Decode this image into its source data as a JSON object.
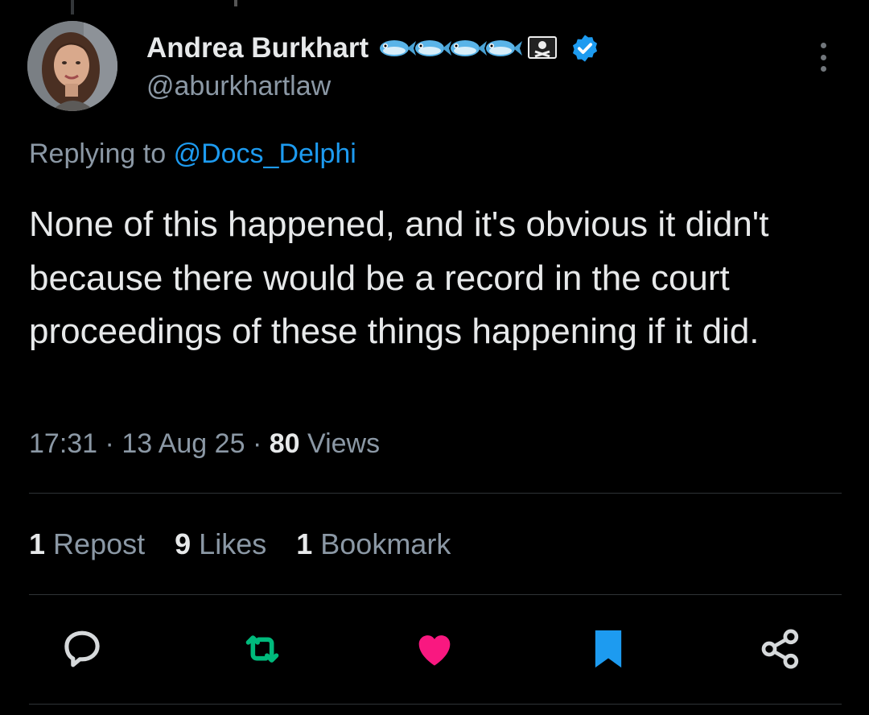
{
  "author": {
    "name": "Andrea Burkhart",
    "handle": "@aburkhartlaw",
    "verified": true,
    "name_emojis": [
      "fish",
      "fish",
      "fish",
      "fish",
      "pirate-flag"
    ]
  },
  "reply": {
    "prefix": "Replying to",
    "mention": "@Docs_Delphi"
  },
  "tweet": {
    "text": "None of this happened, and it's obvious it didn't because there would be a record in the court proceedings of these things happening if it did.",
    "time": "17:31",
    "date": "13 Aug 25",
    "views_count": "80",
    "views_label": "Views",
    "separator": "·"
  },
  "stats": {
    "reposts_count": "1",
    "reposts_label": "Repost",
    "likes_count": "9",
    "likes_label": "Likes",
    "bookmarks_count": "1",
    "bookmarks_label": "Bookmark"
  },
  "actions": [
    {
      "name": "reply",
      "icon": "reply-icon",
      "color": "#71767b"
    },
    {
      "name": "repost",
      "icon": "repost-icon",
      "color": "#00ba7c",
      "active": true
    },
    {
      "name": "like",
      "icon": "heart-icon",
      "color": "#f91880",
      "active": true
    },
    {
      "name": "bookmark",
      "icon": "bookmark-icon",
      "color": "#1d9bf0",
      "active": true
    },
    {
      "name": "share",
      "icon": "share-icon",
      "color": "#71767b"
    }
  ],
  "colors": {
    "background": "#000000",
    "text": "#e7e9ea",
    "secondary": "#8b98a5",
    "accent": "#1d9bf0"
  }
}
